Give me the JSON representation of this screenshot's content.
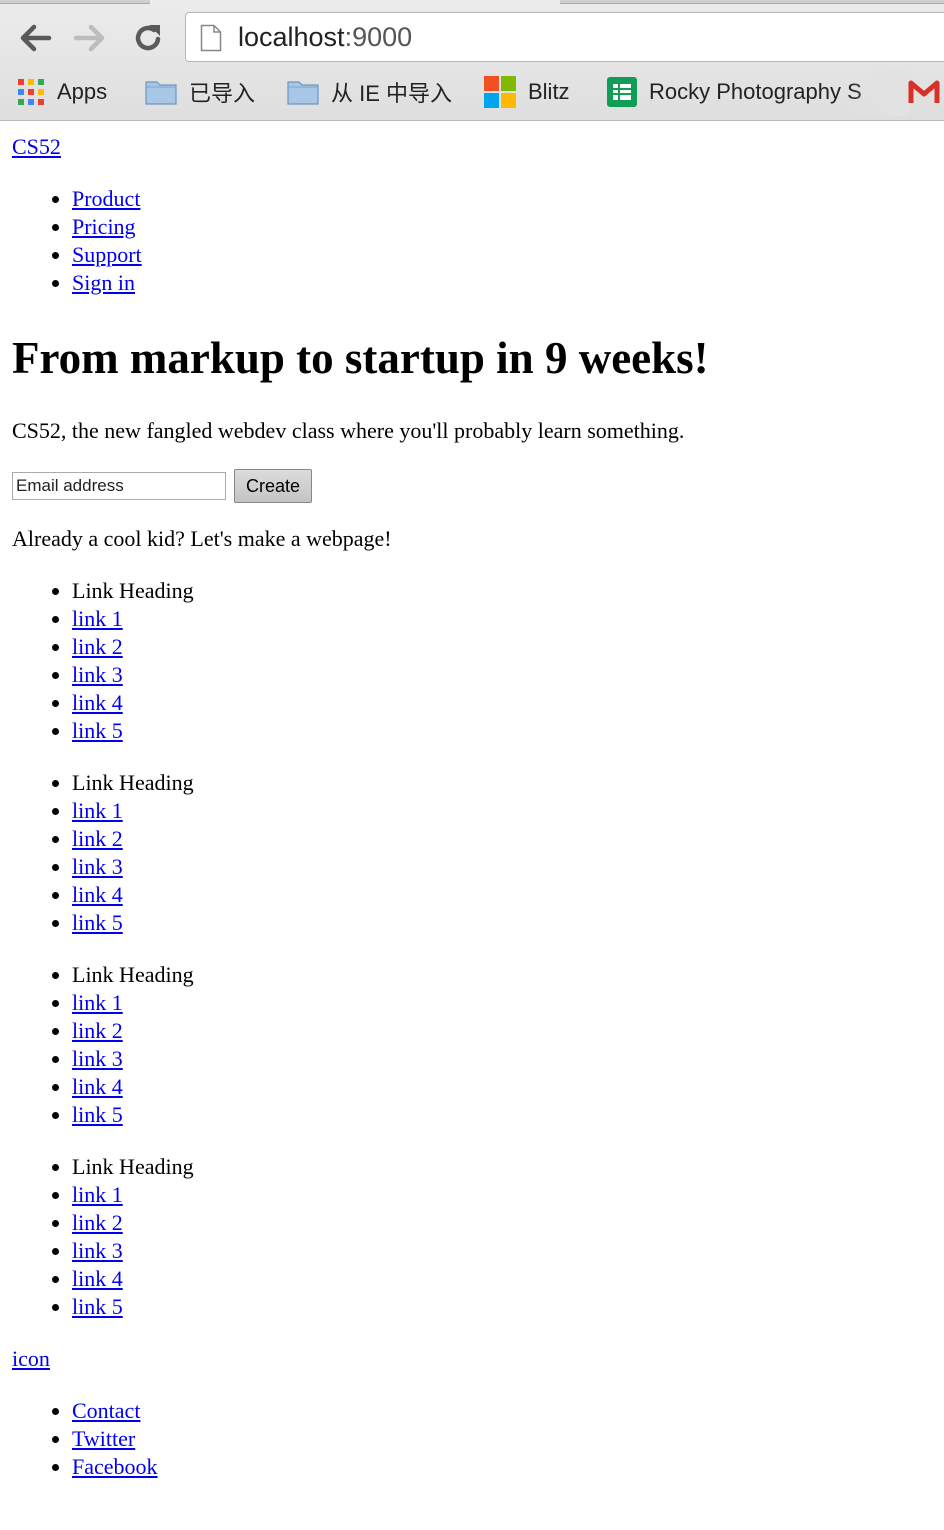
{
  "browser": {
    "url_host": "localhost",
    "url_port": ":9000",
    "bookmarks": [
      {
        "label": "Apps",
        "icon": "apps-grid-icon"
      },
      {
        "label": "已导入",
        "icon": "folder-icon"
      },
      {
        "label": "从 IE 中导入",
        "icon": "folder-icon"
      },
      {
        "label": "Blitz",
        "icon": "windows-logo-icon"
      },
      {
        "label": "Rocky Photography S",
        "icon": "sheets-icon"
      },
      {
        "label": "",
        "icon": "gmail-icon"
      }
    ]
  },
  "header": {
    "logo": "CS52",
    "nav": [
      "Product",
      "Pricing",
      "Support",
      "Sign in"
    ]
  },
  "hero": {
    "title": "From markup to startup in 9 weeks!",
    "lead": "CS52, the new fangled webdev class where you'll probably learn something.",
    "email_placeholder": "Email address",
    "create_label": "Create",
    "tagline": "Already a cool kid? Let's make a webpage!"
  },
  "link_groups": [
    {
      "heading": "Link Heading",
      "links": [
        "link 1",
        "link 2",
        "link 3",
        "link 4",
        "link 5"
      ]
    },
    {
      "heading": "Link Heading",
      "links": [
        "link 1",
        "link 2",
        "link 3",
        "link 4",
        "link 5"
      ]
    },
    {
      "heading": "Link Heading",
      "links": [
        "link 1",
        "link 2",
        "link 3",
        "link 4",
        "link 5"
      ]
    },
    {
      "heading": "Link Heading",
      "links": [
        "link 1",
        "link 2",
        "link 3",
        "link 4",
        "link 5"
      ]
    }
  ],
  "footer": {
    "icon_link": "icon",
    "links": [
      "Contact",
      "Twitter",
      "Facebook"
    ]
  }
}
